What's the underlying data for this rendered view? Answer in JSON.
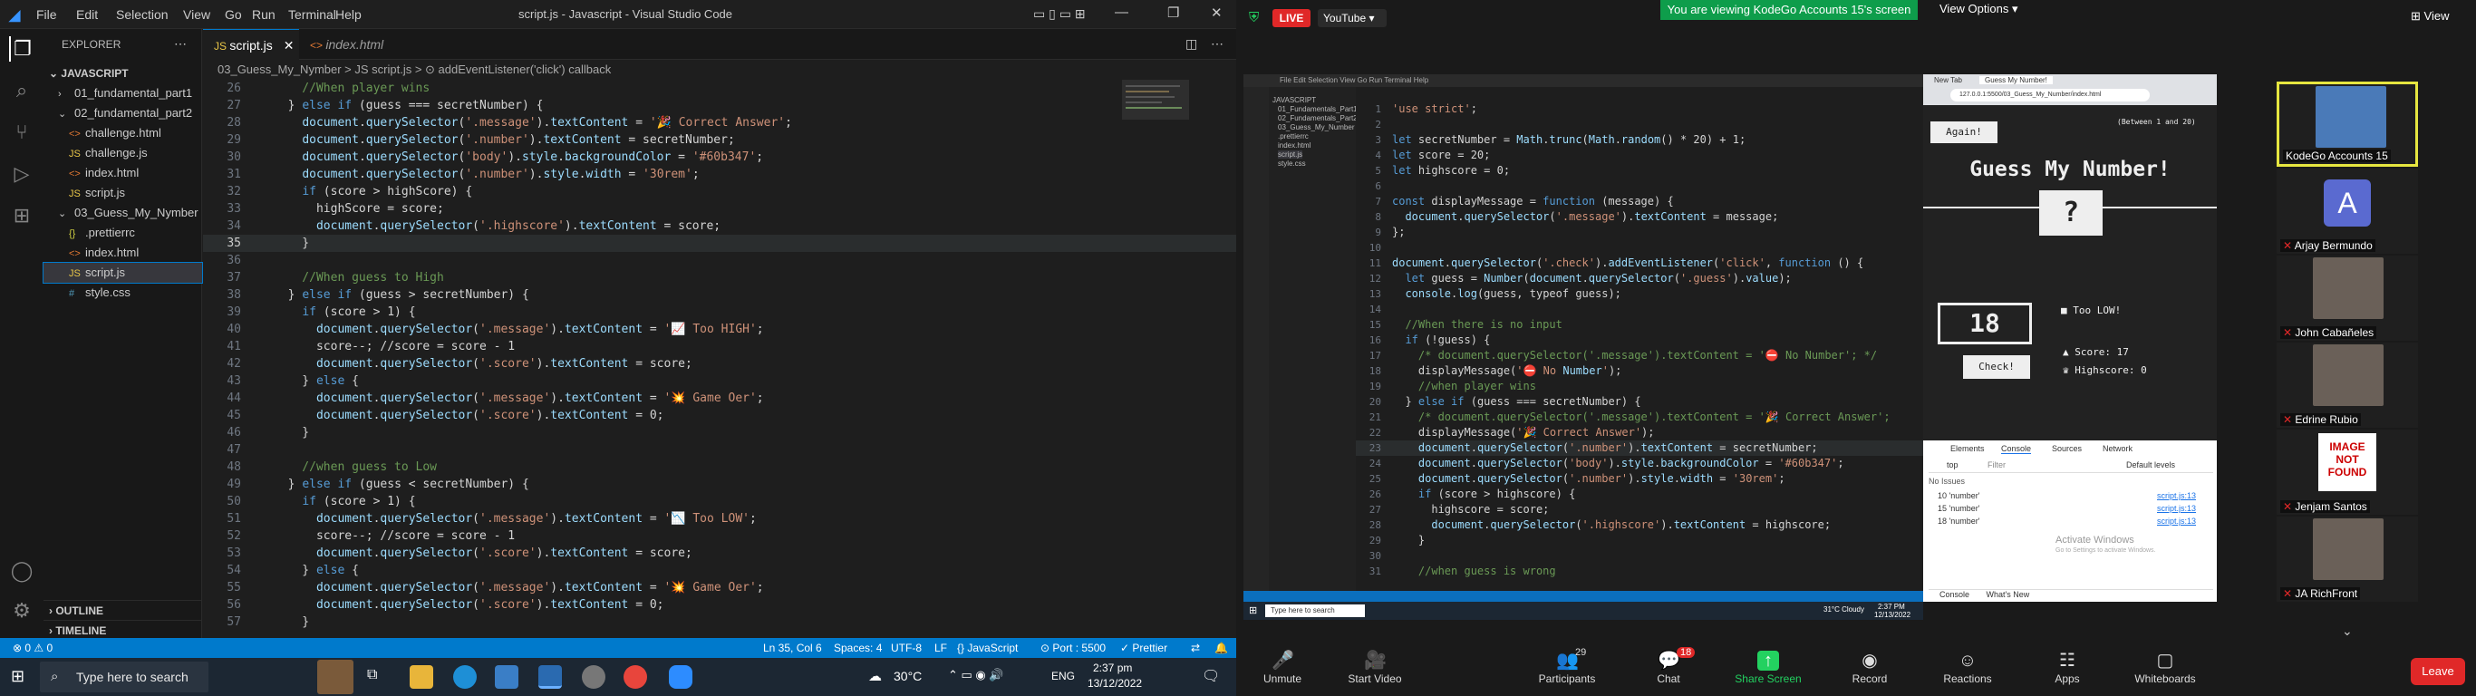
{
  "vscode": {
    "title": "script.js - Javascript - Visual Studio Code",
    "menu": [
      "File",
      "Edit",
      "Selection",
      "View",
      "Go",
      "Run",
      "Terminal",
      "Help"
    ],
    "explorer_label": "EXPLORER",
    "folder_root": "JAVASCRIPT",
    "tree": [
      {
        "label": "01_fundamental_part1",
        "indent": 1,
        "type": "folder-collapsed"
      },
      {
        "label": "02_fundamental_part2",
        "indent": 1,
        "type": "folder-open"
      },
      {
        "label": "challenge.html",
        "indent": 2,
        "type": "html"
      },
      {
        "label": "challenge.js",
        "indent": 2,
        "type": "js"
      },
      {
        "label": "index.html",
        "indent": 2,
        "type": "html"
      },
      {
        "label": "script.js",
        "indent": 2,
        "type": "js"
      },
      {
        "label": "03_Guess_My_Nymber",
        "indent": 1,
        "type": "folder-open"
      },
      {
        "label": ".prettierrc",
        "indent": 2,
        "type": "rc"
      },
      {
        "label": "index.html",
        "indent": 2,
        "type": "html"
      },
      {
        "label": "script.js",
        "indent": 2,
        "type": "js",
        "selected": true
      },
      {
        "label": "style.css",
        "indent": 2,
        "type": "css"
      }
    ],
    "outline_label": "OUTLINE",
    "timeline_label": "TIMELINE",
    "tabs": [
      {
        "label": "script.js",
        "active": true
      },
      {
        "label": "index.html",
        "active": false
      }
    ],
    "breadcrumb": "03_Guess_My_Nymber  >  JS script.js  >  ⊙ addEventListener('click') callback",
    "status": {
      "errors": "⊗ 0 ⚠ 0",
      "position": "Ln 35, Col 6",
      "spaces": "Spaces: 4",
      "encoding": "UTF-8",
      "eol": "LF",
      "language": "{} JavaScript",
      "port": "⊙ Port : 5500",
      "prettier": "✓ Prettier"
    },
    "code_lines": [
      {
        "n": "26",
        "t": "    //When player wins",
        "cls": "c"
      },
      {
        "n": "27",
        "t": "  } else if (guess === secretNumber) {",
        "cls": "p"
      },
      {
        "n": "28",
        "t": "    document.querySelector('.message').textContent = '🎉 Correct Answer';",
        "cls": "p"
      },
      {
        "n": "29",
        "t": "    document.querySelector('.number').textContent = secretNumber;",
        "cls": "p"
      },
      {
        "n": "30",
        "t": "    document.querySelector('body').style.backgroundColor = '#60b347';",
        "cls": "p"
      },
      {
        "n": "31",
        "t": "    document.querySelector('.number').style.width = '30rem';",
        "cls": "p"
      },
      {
        "n": "32",
        "t": "    if (score > highScore) {",
        "cls": "p"
      },
      {
        "n": "33",
        "t": "      highScore = score;",
        "cls": "p"
      },
      {
        "n": "34",
        "t": "      document.querySelector('.highscore').textContent = score;",
        "cls": "p"
      },
      {
        "n": "35",
        "t": "    }",
        "cls": "p"
      },
      {
        "n": "36",
        "t": "",
        "cls": "p"
      },
      {
        "n": "37",
        "t": "    //When guess to High",
        "cls": "c"
      },
      {
        "n": "38",
        "t": "  } else if (guess > secretNumber) {",
        "cls": "p"
      },
      {
        "n": "39",
        "t": "    if (score > 1) {",
        "cls": "p"
      },
      {
        "n": "40",
        "t": "      document.querySelector('.message').textContent = '📈 Too HIGH';",
        "cls": "p"
      },
      {
        "n": "41",
        "t": "      score--; //score = score - 1",
        "cls": "p"
      },
      {
        "n": "42",
        "t": "      document.querySelector('.score').textContent = score;",
        "cls": "p"
      },
      {
        "n": "43",
        "t": "    } else {",
        "cls": "p"
      },
      {
        "n": "44",
        "t": "      document.querySelector('.message').textContent = '💥 Game Oer';",
        "cls": "p"
      },
      {
        "n": "45",
        "t": "      document.querySelector('.score').textContent = 0;",
        "cls": "p"
      },
      {
        "n": "46",
        "t": "    }",
        "cls": "p"
      },
      {
        "n": "47",
        "t": "",
        "cls": "p"
      },
      {
        "n": "48",
        "t": "    //when guess to Low",
        "cls": "c"
      },
      {
        "n": "49",
        "t": "  } else if (guess < secretNumber) {",
        "cls": "p"
      },
      {
        "n": "50",
        "t": "    if (score > 1) {",
        "cls": "p"
      },
      {
        "n": "51",
        "t": "      document.querySelector('.message').textContent = '📉 Too LOW';",
        "cls": "p"
      },
      {
        "n": "52",
        "t": "      score--; //score = score - 1",
        "cls": "p"
      },
      {
        "n": "53",
        "t": "      document.querySelector('.score').textContent = score;",
        "cls": "p"
      },
      {
        "n": "54",
        "t": "    } else {",
        "cls": "p"
      },
      {
        "n": "55",
        "t": "      document.querySelector('.message').textContent = '💥 Game Oer';",
        "cls": "p"
      },
      {
        "n": "56",
        "t": "      document.querySelector('.score').textContent = 0;",
        "cls": "p"
      },
      {
        "n": "57",
        "t": "    }",
        "cls": "p"
      }
    ]
  },
  "taskbar": {
    "search_placeholder": "Type here to search",
    "weather": "30°C",
    "lang": "ENG",
    "time": "2:37 pm",
    "date": "13/12/2022"
  },
  "zoom": {
    "live": "LIVE",
    "youtube": "YouTube",
    "banner": "You are viewing KodeGo Accounts 15's screen",
    "view_options": "View Options",
    "view": "View",
    "toolbar": [
      {
        "label": "Unmute",
        "icon": "mic-off-icon",
        "glyph": "🎤"
      },
      {
        "label": "Start Video",
        "icon": "video-off-icon",
        "glyph": "🎥"
      },
      {
        "label": "Participants",
        "icon": "participants-icon",
        "glyph": "👥",
        "badge": "29"
      },
      {
        "label": "Chat",
        "icon": "chat-icon",
        "glyph": "💬",
        "badge": "18"
      },
      {
        "label": "Share Screen",
        "icon": "share-screen-icon",
        "glyph": "↑"
      },
      {
        "label": "Record",
        "icon": "record-icon",
        "glyph": "◉"
      },
      {
        "label": "Reactions",
        "icon": "reactions-icon",
        "glyph": "☺"
      },
      {
        "label": "Apps",
        "icon": "apps-icon",
        "glyph": "☷"
      },
      {
        "label": "Whiteboards",
        "icon": "whiteboard-icon",
        "glyph": "▢"
      }
    ],
    "leave": "Leave",
    "participants": [
      {
        "name": "KodeGo Accounts 15",
        "type": "video",
        "muted": false
      },
      {
        "name": "Arjay Bermundo",
        "type": "avatar",
        "initial": "A",
        "muted": true
      },
      {
        "name": "John Cabañeles",
        "type": "video",
        "muted": true
      },
      {
        "name": "Edrine Rubio",
        "type": "video",
        "muted": true
      },
      {
        "name": "Jenjam Santos",
        "type": "image-not-found",
        "muted": true,
        "img_text": "IMAGE NOT FOUND"
      },
      {
        "name": "JA RichFront",
        "type": "video",
        "muted": true
      }
    ]
  },
  "shared": {
    "code_lines": [
      {
        "n": "1",
        "t": "'use strict';"
      },
      {
        "n": "2",
        "t": ""
      },
      {
        "n": "3",
        "t": "let secretNumber = Math.trunc(Math.random() * 20) + 1;"
      },
      {
        "n": "4",
        "t": "let score = 20;"
      },
      {
        "n": "5",
        "t": "let highscore = 0;"
      },
      {
        "n": "6",
        "t": ""
      },
      {
        "n": "7",
        "t": "const displayMessage = function (message) {"
      },
      {
        "n": "8",
        "t": "  document.querySelector('.message').textContent = message;"
      },
      {
        "n": "9",
        "t": "};"
      },
      {
        "n": "10",
        "t": ""
      },
      {
        "n": "11",
        "t": "document.querySelector('.check').addEventListener('click', function () {"
      },
      {
        "n": "12",
        "t": "  let guess = Number(document.querySelector('.guess').value);"
      },
      {
        "n": "13",
        "t": "  console.log(guess, typeof guess);"
      },
      {
        "n": "14",
        "t": ""
      },
      {
        "n": "15",
        "t": "  //When there is no input"
      },
      {
        "n": "16",
        "t": "  if (!guess) {"
      },
      {
        "n": "17",
        "t": "    /* document.querySelector('.message').textContent = '⛔ No Number'; */"
      },
      {
        "n": "18",
        "t": "    displayMessage('⛔ No Number');"
      },
      {
        "n": "19",
        "t": "    //when player wins"
      },
      {
        "n": "20",
        "t": "  } else if (guess === secretNumber) {"
      },
      {
        "n": "21",
        "t": "    /* document.querySelector('.message').textContent = '🎉 Correct Answer';"
      },
      {
        "n": "22",
        "t": "    displayMessage('🎉 Correct Answer');"
      },
      {
        "n": "23",
        "t": "    document.querySelector('.number').textContent = secretNumber;"
      },
      {
        "n": "24",
        "t": "    document.querySelector('body').style.backgroundColor = '#60b347';"
      },
      {
        "n": "25",
        "t": "    document.querySelector('.number').style.width = '30rem';"
      },
      {
        "n": "26",
        "t": "    if (score > highscore) {"
      },
      {
        "n": "27",
        "t": "      highscore = score;"
      },
      {
        "n": "28",
        "t": "      document.querySelector('.highscore').textContent = highscore;"
      },
      {
        "n": "29",
        "t": "    }"
      },
      {
        "n": "30",
        "t": ""
      },
      {
        "n": "31",
        "t": "    //when guess is wrong"
      }
    ],
    "tree": [
      "JAVASCRIPT",
      "01_Fundamentals_Part1",
      "02_Fundamentals_Part2",
      "03_Guess_My_Number",
      ".prettierrc",
      "index.html",
      "script.js",
      "style.css"
    ],
    "game": {
      "again": "Again!",
      "range": "(Between 1 and 20)",
      "title": "Guess My Number!",
      "number": "?",
      "guess_value": "18",
      "message": "Too LOW!",
      "score_label": "Score:",
      "score": "17",
      "highscore_label": "Highscore:",
      "highscore": "0",
      "check": "Check!"
    },
    "devtools": {
      "tabs": [
        "Elements",
        "Console",
        "Sources",
        "Network"
      ],
      "context": "top",
      "filter_placeholder": "Filter",
      "levels": "Default levels",
      "issues": "No Issues",
      "logs": [
        {
          "msg": "10 'number'",
          "src": "script.js:13"
        },
        {
          "msg": "15 'number'",
          "src": "script.js:13"
        },
        {
          "msg": "18 'number'",
          "src": "script.js:13"
        }
      ],
      "activate": "Activate Windows",
      "activate_sub": "Go to Settings to activate Windows.",
      "drawer": [
        "Console",
        "What's New"
      ]
    },
    "browser_tabs": [
      "New Tab",
      "Guess My Number!"
    ],
    "url": "127.0.0.1:5500/03_Guess_My_Number/index.html",
    "mini_time": "2:37 PM",
    "mini_date": "12/13/2022",
    "mini_weather": "31°C  Cloudy",
    "mini_search": "Type here to search"
  }
}
